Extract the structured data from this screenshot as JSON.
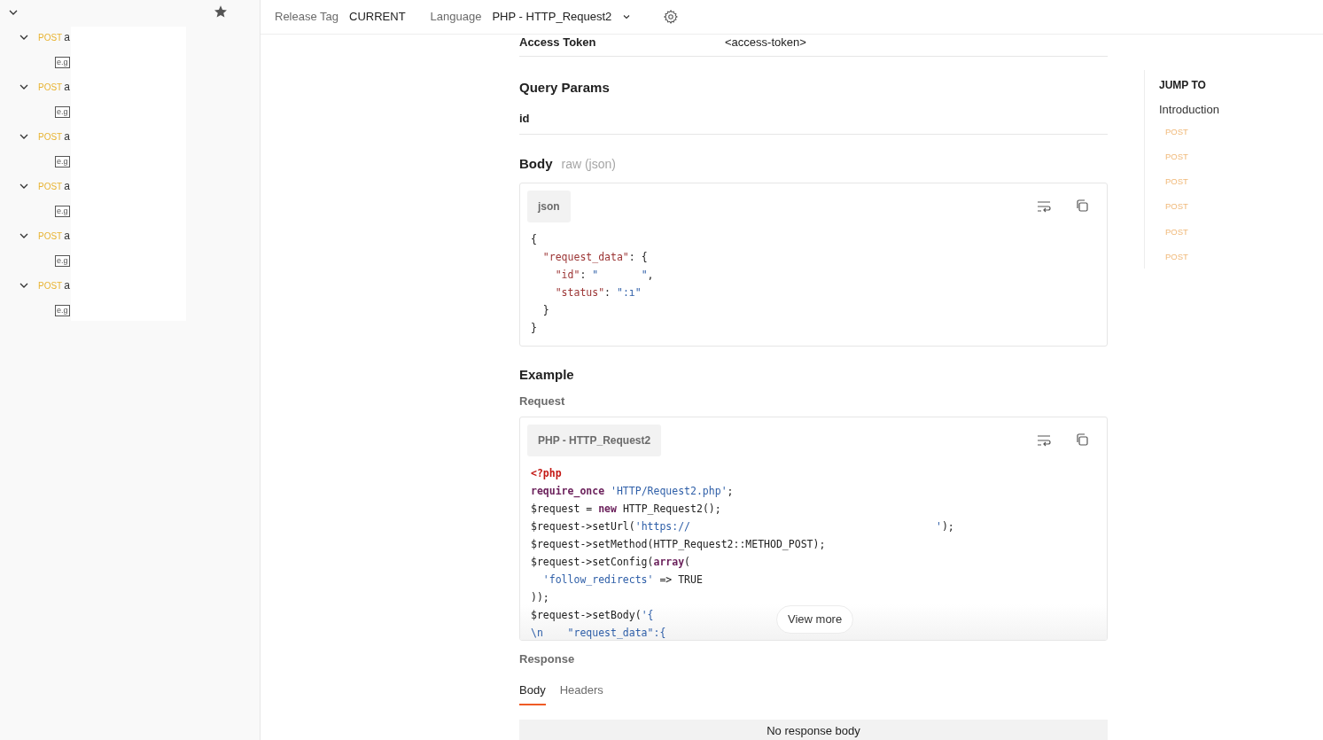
{
  "sidebar": {
    "folder": {
      "expanded": true
    },
    "requests": [
      {
        "method": "POST",
        "name": "a",
        "expanded": true,
        "example": "e.g"
      },
      {
        "method": "POST",
        "name": "a",
        "expanded": true,
        "example": "e.g"
      },
      {
        "method": "POST",
        "name": "a",
        "expanded": true,
        "example": "e.g"
      },
      {
        "method": "POST",
        "name": "a",
        "expanded": true,
        "example": "e.g"
      },
      {
        "method": "POST",
        "name": "a",
        "expanded": true,
        "example": "e.g"
      },
      {
        "method": "POST",
        "name": "a",
        "expanded": true,
        "example": "e.g"
      }
    ]
  },
  "toolbar": {
    "release_tag_label": "Release Tag",
    "release_tag": "CURRENT",
    "language_label": "Language",
    "language": "PHP - HTTP_Request2"
  },
  "auth": {
    "key": "Access Token",
    "value": "<access-token>"
  },
  "query_params": {
    "title": "Query Params",
    "params": [
      {
        "key": "id"
      }
    ]
  },
  "body": {
    "title": "Body",
    "type": "raw (json)",
    "language": "json",
    "lines": [
      [
        {
          "kind": "plain",
          "text": "{"
        }
      ],
      [
        {
          "kind": "key",
          "text": "  \"request_data\""
        },
        {
          "kind": "plain",
          "text": ": {"
        }
      ],
      [
        {
          "kind": "key",
          "text": "    \"id\""
        },
        {
          "kind": "plain",
          "text": ": "
        },
        {
          "kind": "str",
          "text": "\"       \""
        },
        {
          "kind": "plain",
          "text": ","
        }
      ],
      [
        {
          "kind": "key",
          "text": "    \"status\""
        },
        {
          "kind": "plain",
          "text": ": "
        },
        {
          "kind": "str",
          "text": "\":ı\""
        }
      ],
      [
        {
          "kind": "plain",
          "text": "  }"
        }
      ],
      [
        {
          "kind": "plain",
          "text": "}"
        }
      ]
    ]
  },
  "example": {
    "title": "Example",
    "request_label": "Request",
    "language": "PHP - HTTP_Request2",
    "view_more": "View more",
    "lines": [
      [
        {
          "kind": "tag",
          "text": "<?php"
        }
      ],
      [
        {
          "kind": "kw",
          "text": "require_once"
        },
        {
          "kind": "str",
          "text": " 'HTTP/Request2.php'"
        },
        {
          "kind": "plain",
          "text": ";"
        }
      ],
      [
        {
          "kind": "plain",
          "text": "$request = "
        },
        {
          "kind": "kw",
          "text": "new"
        },
        {
          "kind": "plain",
          "text": " HTTP_Request2();"
        }
      ],
      [
        {
          "kind": "plain",
          "text": "$request->setUrl("
        },
        {
          "kind": "str",
          "text": "'https://                                        '"
        },
        {
          "kind": "plain",
          "text": ");"
        }
      ],
      [
        {
          "kind": "plain",
          "text": "$request->setMethod(HTTP_Request2::METHOD_POST);"
        }
      ],
      [
        {
          "kind": "plain",
          "text": "$request->setConfig("
        },
        {
          "kind": "kw",
          "text": "array"
        },
        {
          "kind": "plain",
          "text": "("
        }
      ],
      [
        {
          "kind": "str",
          "text": "  'follow_redirects'"
        },
        {
          "kind": "plain",
          "text": " => TRUE"
        }
      ],
      [
        {
          "kind": "plain",
          "text": "));"
        }
      ],
      [
        {
          "kind": "plain",
          "text": "$request->setBody("
        },
        {
          "kind": "str",
          "text": "'{"
        }
      ],
      [
        {
          "kind": "str",
          "text": "\\n    \"request_data\":{"
        }
      ]
    ]
  },
  "response": {
    "title": "Response",
    "tabs": [
      {
        "label": "Body",
        "selected": true
      },
      {
        "label": "Headers",
        "selected": false
      }
    ],
    "empty": "No response body"
  },
  "jump_to": {
    "title": "JUMP TO",
    "intro": "Introduction",
    "items": [
      {
        "method": "POST"
      },
      {
        "method": "POST"
      },
      {
        "method": "POST"
      },
      {
        "method": "POST"
      },
      {
        "method": "POST"
      },
      {
        "method": "POST"
      }
    ]
  }
}
